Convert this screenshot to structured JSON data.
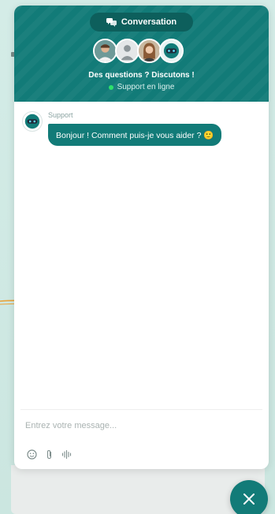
{
  "header": {
    "conversation_label": "Conversation",
    "title": "Des questions ? Discutons !",
    "status": "Support en ligne"
  },
  "message": {
    "sender": "Support",
    "text": "Bonjour ! Comment puis-je vous aider ? 🙂"
  },
  "composer": {
    "placeholder": "Entrez votre message..."
  },
  "icons": {
    "conversation": "chat-bubbles-icon",
    "emoji": "smiley-icon",
    "attach": "paperclip-icon",
    "voice": "audio-wave-icon",
    "close": "close-icon"
  },
  "colors": {
    "brand": "#127b78",
    "brand_dark": "#0d5f5c",
    "online": "#2ee06b",
    "accent_arrow": "#e8a23a"
  }
}
